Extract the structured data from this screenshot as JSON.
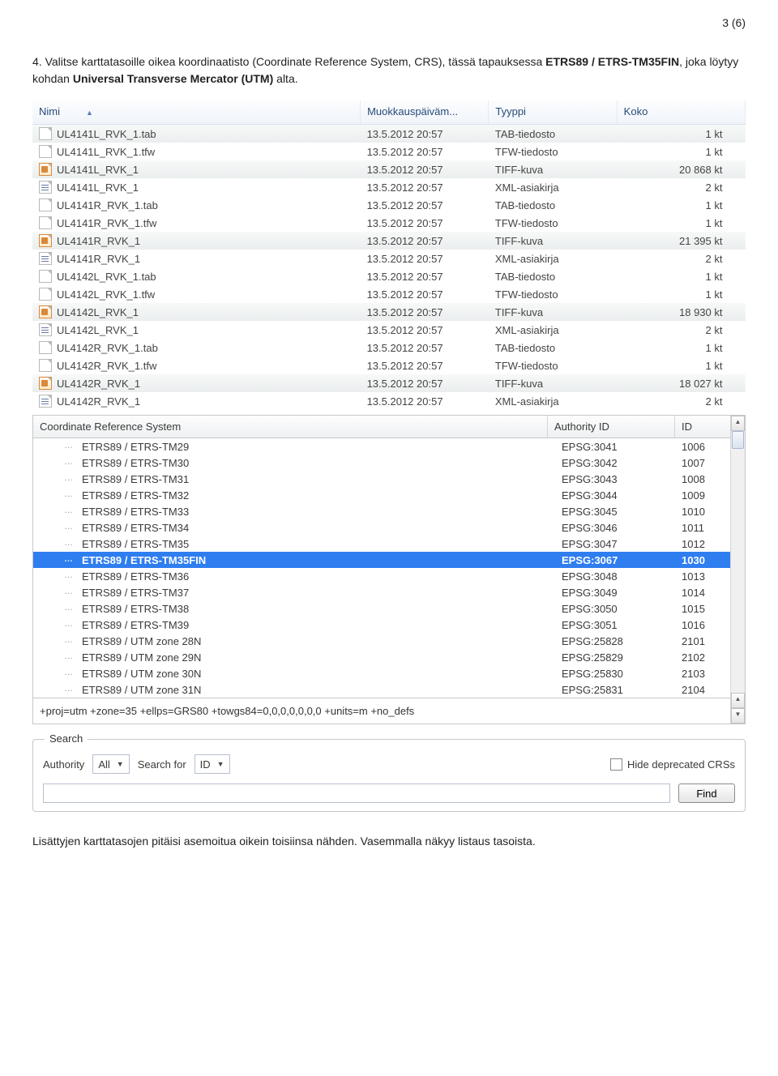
{
  "page_indicator": "3 (6)",
  "instruction_prefix": "4. Valitse karttatasoille oikea koordinaatisto (Coordinate Reference System, CRS), tässä tapauksessa ",
  "instruction_bold1": "ETRS89 / ETRS-TM35FIN",
  "instruction_mid": ", joka löytyy kohdan ",
  "instruction_bold2": "Universal Transverse Mercator (UTM)",
  "instruction_suffix": " alta.",
  "file_table": {
    "headers": {
      "name": "Nimi",
      "modified": "Muokkauspäiväm...",
      "type": "Tyyppi",
      "size": "Koko"
    },
    "rows": [
      {
        "icon": "file",
        "name": "UL4141L_RVK_1.tab",
        "date": "13.5.2012 20:57",
        "type": "TAB-tiedosto",
        "size": "1 kt",
        "sel": true
      },
      {
        "icon": "file",
        "name": "UL4141L_RVK_1.tfw",
        "date": "13.5.2012 20:57",
        "type": "TFW-tiedosto",
        "size": "1 kt"
      },
      {
        "icon": "tiff",
        "name": "UL4141L_RVK_1",
        "date": "13.5.2012 20:57",
        "type": "TIFF-kuva",
        "size": "20 868 kt",
        "sel": true
      },
      {
        "icon": "xml",
        "name": "UL4141L_RVK_1",
        "date": "13.5.2012 20:57",
        "type": "XML-asiakirja",
        "size": "2 kt"
      },
      {
        "icon": "file",
        "name": "UL4141R_RVK_1.tab",
        "date": "13.5.2012 20:57",
        "type": "TAB-tiedosto",
        "size": "1 kt"
      },
      {
        "icon": "file",
        "name": "UL4141R_RVK_1.tfw",
        "date": "13.5.2012 20:57",
        "type": "TFW-tiedosto",
        "size": "1 kt"
      },
      {
        "icon": "tiff",
        "name": "UL4141R_RVK_1",
        "date": "13.5.2012 20:57",
        "type": "TIFF-kuva",
        "size": "21 395 kt",
        "sel": true
      },
      {
        "icon": "xml",
        "name": "UL4141R_RVK_1",
        "date": "13.5.2012 20:57",
        "type": "XML-asiakirja",
        "size": "2 kt"
      },
      {
        "icon": "file",
        "name": "UL4142L_RVK_1.tab",
        "date": "13.5.2012 20:57",
        "type": "TAB-tiedosto",
        "size": "1 kt"
      },
      {
        "icon": "file",
        "name": "UL4142L_RVK_1.tfw",
        "date": "13.5.2012 20:57",
        "type": "TFW-tiedosto",
        "size": "1 kt"
      },
      {
        "icon": "tiff",
        "name": "UL4142L_RVK_1",
        "date": "13.5.2012 20:57",
        "type": "TIFF-kuva",
        "size": "18 930 kt",
        "sel": true
      },
      {
        "icon": "xml",
        "name": "UL4142L_RVK_1",
        "date": "13.5.2012 20:57",
        "type": "XML-asiakirja",
        "size": "2 kt"
      },
      {
        "icon": "file",
        "name": "UL4142R_RVK_1.tab",
        "date": "13.5.2012 20:57",
        "type": "TAB-tiedosto",
        "size": "1 kt"
      },
      {
        "icon": "file",
        "name": "UL4142R_RVK_1.tfw",
        "date": "13.5.2012 20:57",
        "type": "TFW-tiedosto",
        "size": "1 kt"
      },
      {
        "icon": "tiff",
        "name": "UL4142R_RVK_1",
        "date": "13.5.2012 20:57",
        "type": "TIFF-kuva",
        "size": "18 027 kt",
        "sel": true
      },
      {
        "icon": "xml",
        "name": "UL4142R_RVK_1",
        "date": "13.5.2012 20:57",
        "type": "XML-asiakirja",
        "size": "2 kt"
      }
    ]
  },
  "crs": {
    "headers": {
      "name": "Coordinate Reference System",
      "auth": "Authority ID",
      "id": "ID"
    },
    "rows": [
      {
        "name": "ETRS89 / ETRS-TM29",
        "auth": "EPSG:3041",
        "id": "1006"
      },
      {
        "name": "ETRS89 / ETRS-TM30",
        "auth": "EPSG:3042",
        "id": "1007"
      },
      {
        "name": "ETRS89 / ETRS-TM31",
        "auth": "EPSG:3043",
        "id": "1008"
      },
      {
        "name": "ETRS89 / ETRS-TM32",
        "auth": "EPSG:3044",
        "id": "1009"
      },
      {
        "name": "ETRS89 / ETRS-TM33",
        "auth": "EPSG:3045",
        "id": "1010"
      },
      {
        "name": "ETRS89 / ETRS-TM34",
        "auth": "EPSG:3046",
        "id": "1011"
      },
      {
        "name": "ETRS89 / ETRS-TM35",
        "auth": "EPSG:3047",
        "id": "1012"
      },
      {
        "name": "ETRS89 / ETRS-TM35FIN",
        "auth": "EPSG:3067",
        "id": "1030",
        "selected": true
      },
      {
        "name": "ETRS89 / ETRS-TM36",
        "auth": "EPSG:3048",
        "id": "1013"
      },
      {
        "name": "ETRS89 / ETRS-TM37",
        "auth": "EPSG:3049",
        "id": "1014"
      },
      {
        "name": "ETRS89 / ETRS-TM38",
        "auth": "EPSG:3050",
        "id": "1015"
      },
      {
        "name": "ETRS89 / ETRS-TM39",
        "auth": "EPSG:3051",
        "id": "1016"
      },
      {
        "name": "ETRS89 / UTM zone 28N",
        "auth": "EPSG:25828",
        "id": "2101"
      },
      {
        "name": "ETRS89 / UTM zone 29N",
        "auth": "EPSG:25829",
        "id": "2102"
      },
      {
        "name": "ETRS89 / UTM zone 30N",
        "auth": "EPSG:25830",
        "id": "2103"
      },
      {
        "name": "ETRS89 / UTM zone 31N",
        "auth": "EPSG:25831",
        "id": "2104"
      }
    ],
    "proj_string": "+proj=utm +zone=35 +ellps=GRS80 +towgs84=0,0,0,0,0,0,0 +units=m +no_defs"
  },
  "search": {
    "legend": "Search",
    "authority_label": "Authority",
    "authority_value": "All",
    "searchfor_label": "Search for",
    "searchfor_value": "ID",
    "hide_label": "Hide deprecated CRSs",
    "find_label": "Find"
  },
  "footer_text": "Lisättyjen karttatasojen pitäisi asemoitua oikein toisiinsa nähden. Vasemmalla näkyy listaus tasoista."
}
